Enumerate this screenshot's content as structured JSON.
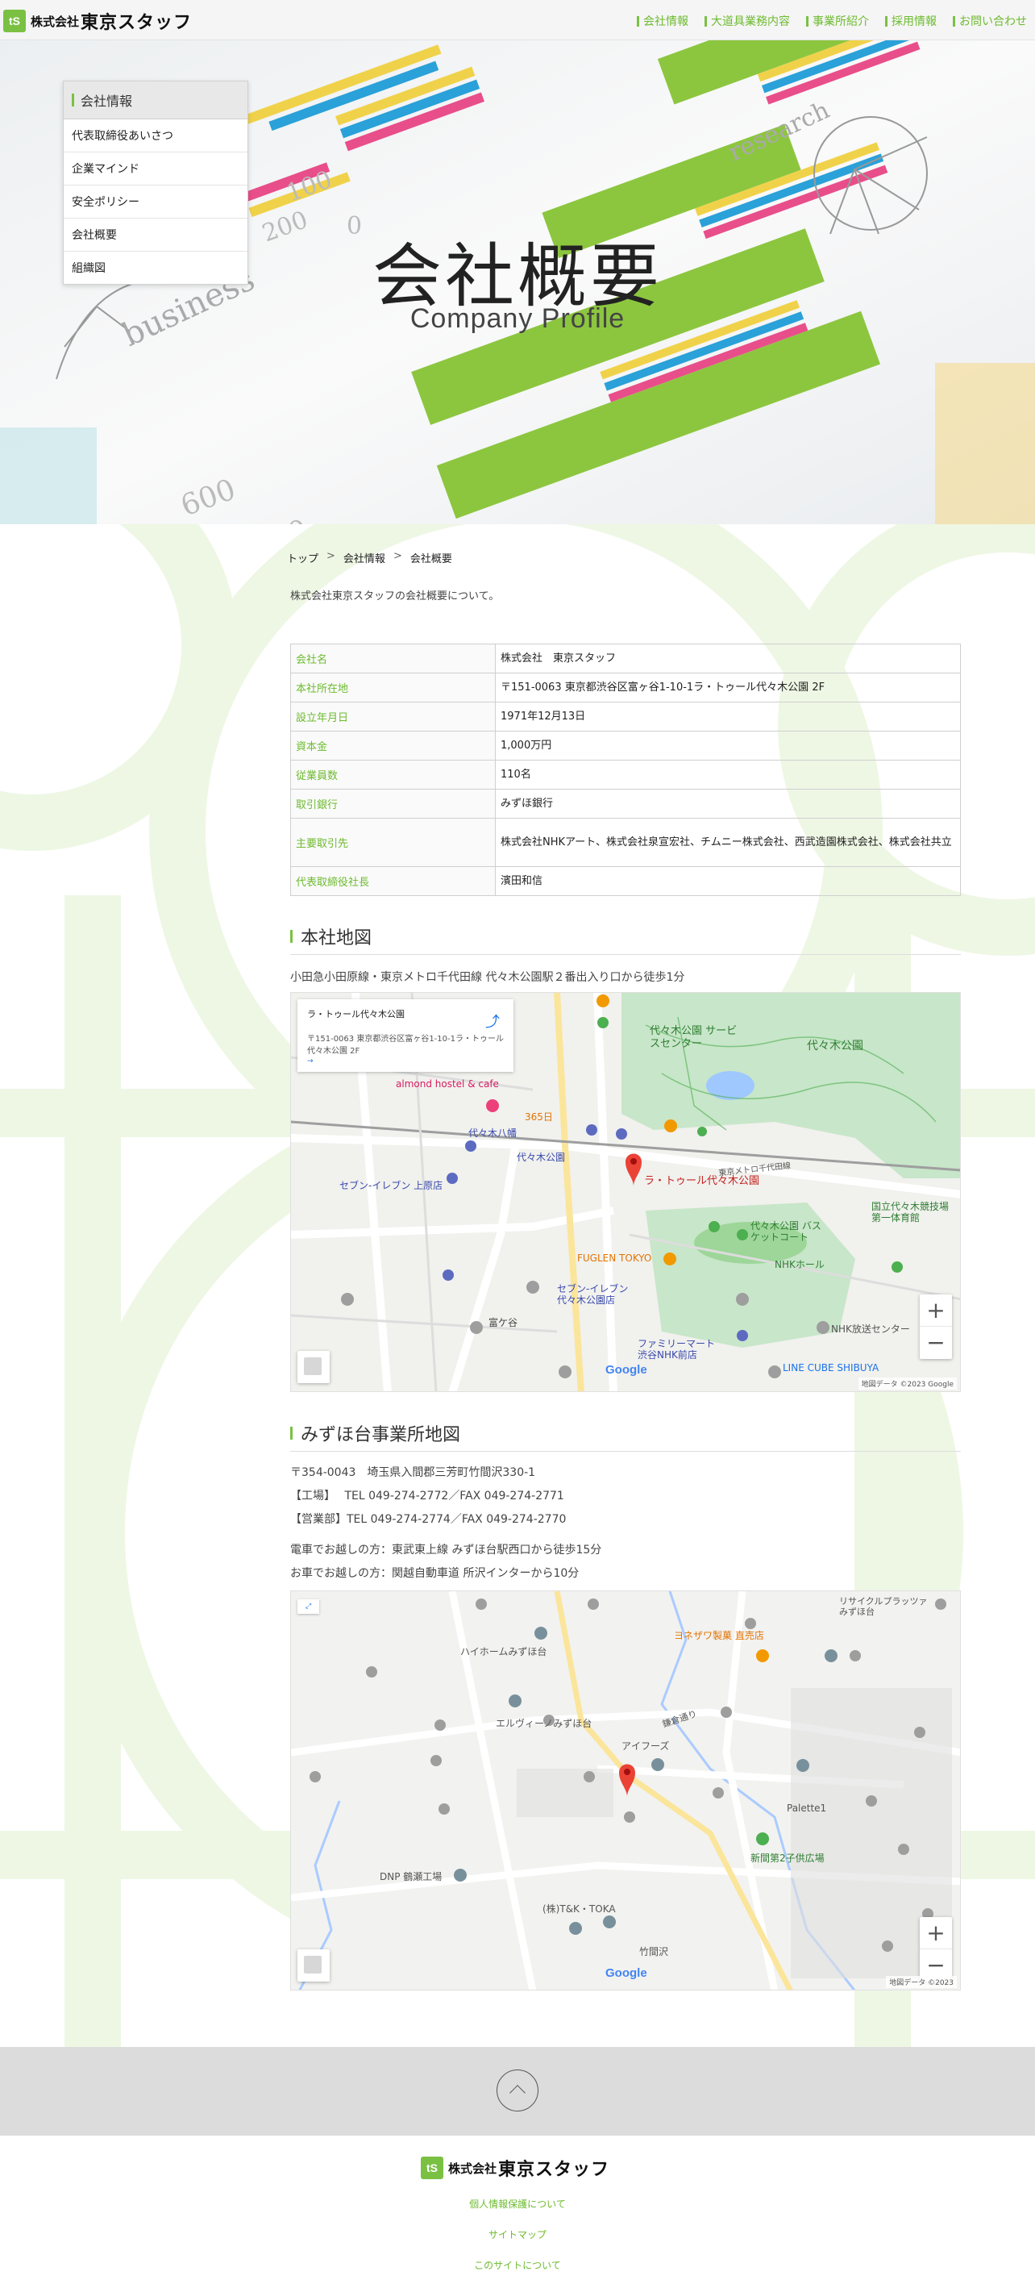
{
  "header": {
    "logo_mark": "tS",
    "logo_prefix": "株式会社",
    "logo_name": "東京スタッフ",
    "nav": [
      "会社情報",
      "大道具業務内容",
      "事業所紹介",
      "採用情報",
      "お問い合わせ"
    ]
  },
  "hero": {
    "title": "会社概要",
    "subtitle": "Company Profile"
  },
  "sidemenu": {
    "heading": "会社情報",
    "items": [
      "代表取締役あいさつ",
      "企業マインド",
      "安全ポリシー",
      "会社概要",
      "組織図"
    ]
  },
  "breadcrumb": [
    "トップ",
    "会社情報",
    "会社概要"
  ],
  "intro": "株式会社東京スタッフの会社概要について。",
  "profile": [
    {
      "label": "会社名",
      "value": "株式会社　東京スタッフ"
    },
    {
      "label": "本社所在地",
      "value": "〒151-0063 東京都渋谷区富ヶ谷1-10-1ラ・トゥール代々木公園 2F"
    },
    {
      "label": "設立年月日",
      "value": "1971年12月13日"
    },
    {
      "label": "資本金",
      "value": "1,000万円"
    },
    {
      "label": "従業員数",
      "value": "110名"
    },
    {
      "label": "取引銀行",
      "value": "みずほ銀行"
    },
    {
      "label": "主要取引先",
      "value": "株式会社NHKアート、株式会社泉宣宏社、チムニー株式会社、西武造園株式会社、株式会社共立"
    },
    {
      "label": "代表取締役社長",
      "value": "濱田和信"
    }
  ],
  "hq_map": {
    "heading": "本社地図",
    "access": "小田急小田原線・東京メトロ千代田線 代々木公園駅２番出入り口から徒歩1分",
    "marker_label": "ラ・トゥール代々木公園",
    "labels": {
      "park": "代々木公園",
      "service_center": "代々木公園 サービスセンター",
      "station": "代々木公園",
      "yoyogi_hachiman": "代々木八幡",
      "fuglen": "FUGLEN TOKYO",
      "nhk_hall": "NHKホール",
      "nhk_center": "NHK放送センター",
      "line_cube": "LINE CUBE SHIBUYA",
      "tomigaya": "富ケ谷",
      "almond": "almond hostel & cafe",
      "familymart": "ファミリーマート 渋谷NHK前店",
      "seven_uehara": "セブン-イレブン 上原店",
      "seven_yoyogi": "セブン-イレブン 代々木公園店",
      "stadium": "国立代々木競技場 第一体育館",
      "basket": "代々木公園 バスケットコート",
      "chiyoda_line": "東京メトロ千代田線",
      "shop_365": "365日"
    },
    "attribution": "地図データ ©2023 Google",
    "google": "Google"
  },
  "branch_map": {
    "heading": "みずほ台事業所地図",
    "address": "〒354-0043　埼玉県入間郡三芳町竹間沢330-1",
    "factory": "【工場】　 TEL 049-274-2772／FAX 049-274-2771",
    "sales": "【営業部】TEL 049-274-2774／FAX 049-274-2770",
    "train": "電車でお越しの方：東武東上線 みずほ台駅西口から徒歩15分",
    "car": "お車でお越しの方：関越自動車道 所沢インターから10分",
    "labels": {
      "yonezawa": "ヨネザワ製菓 直売店",
      "hiheim": "ハイホームみずほ台",
      "elvino": "エルヴィーノみずほ台",
      "aifoods": "アイフーズ",
      "dnp": "DNP 鶴瀬工場",
      "tk": "(株)T&K・TOKA",
      "palette": "Palette1",
      "park2": "新間第2子供広場",
      "recycle": "リサイクルプラッツァ みずほ台",
      "takemazawa": "竹間沢",
      "kamata": "鎌倉通り"
    },
    "attribution": "地図データ ©2023",
    "google": "Google"
  },
  "footer": {
    "links": [
      "個人情報保護について",
      "サイトマップ",
      "このサイトについて"
    ]
  },
  "colors": {
    "accent_green": "#7ac143",
    "link_green": "#6dbb2f",
    "marker_red": "#ea4335"
  }
}
